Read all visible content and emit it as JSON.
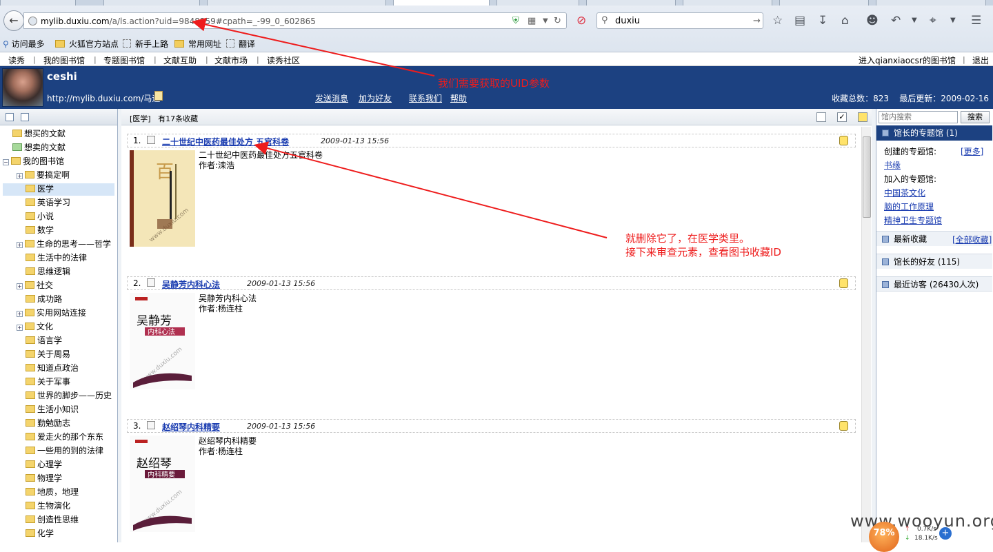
{
  "browser": {
    "url": "mylib.duxiu.com/a/ls.action?uid=9848259#cpath=_-99_0_602865",
    "url_host": "mylib.duxiu.com",
    "url_path": "/a/ls.action?uid=9848259#cpath=_-99_0_602865",
    "search_value": "duxiu",
    "bookmarks": [
      "访问最多",
      "火狐官方站点",
      "新手上路",
      "常用网址",
      "翻译"
    ]
  },
  "topnav": {
    "items": [
      "读秀",
      "我的图书馆",
      "专题图书馆",
      "文献互助",
      "文献市场",
      "读秀社区"
    ],
    "enter_text": "进入qianxiaocsr的图书馆",
    "logout": "退出"
  },
  "profile": {
    "name": "ceshi",
    "url_text": "http://mylib.duxiu.com/马迪",
    "links": [
      "发送消息",
      "加为好友",
      "联系我们",
      "帮助"
    ],
    "stats": "收藏总数：823    最后更新：2009-02-16"
  },
  "tree": {
    "items": [
      {
        "label": "想买的文献"
      },
      {
        "label": "想卖的文献"
      },
      {
        "label": "我的图书馆"
      },
      {
        "label": "要搞定啊"
      },
      {
        "label": "医学"
      },
      {
        "label": "英语学习"
      },
      {
        "label": "小说"
      },
      {
        "label": "数学"
      },
      {
        "label": "生命的思考——哲学"
      },
      {
        "label": "生活中的法律"
      },
      {
        "label": "思维逻辑"
      },
      {
        "label": "社交"
      },
      {
        "label": "成功路"
      },
      {
        "label": "实用网站连接"
      },
      {
        "label": "文化"
      },
      {
        "label": "语言学"
      },
      {
        "label": "关于周易"
      },
      {
        "label": "知道点政治"
      },
      {
        "label": "关于军事"
      },
      {
        "label": "世界的脚步——历史"
      },
      {
        "label": "生活小知识"
      },
      {
        "label": "勤勉励志"
      },
      {
        "label": "爱走火的那个东东"
      },
      {
        "label": "一些用的到的法律"
      },
      {
        "label": "心理学"
      },
      {
        "label": "物理学"
      },
      {
        "label": "地质，地理"
      },
      {
        "label": "生物演化"
      },
      {
        "label": "创造性思维"
      },
      {
        "label": "化学"
      }
    ]
  },
  "main": {
    "category": "[医学]",
    "count_text": "有17条收藏",
    "items": [
      {
        "num": "1.",
        "title": "二十世纪中医药最佳处方 五官科卷",
        "date": "2009-01-13  15:56",
        "desc_title": "二十世纪中医药最佳处方五官科卷",
        "author": "作者:滦浩"
      },
      {
        "num": "2.",
        "title": "吴静芳内科心法",
        "date": "2009-01-13  15:56",
        "desc_title": "吴静芳内科心法",
        "author": "作者:杨连柱"
      },
      {
        "num": "3.",
        "title": "赵绍琴内科精要",
        "date": "2009-01-13  15:56",
        "desc_title": "赵绍琴内科精要",
        "author": "作者:杨连柱"
      }
    ]
  },
  "right": {
    "search_placeholder": "馆内搜索",
    "search_button": "搜索",
    "topic_head": "馆长的专题馆 (1)",
    "created_label": "创建的专题馆:",
    "more": "[更多]",
    "created_link": "书缘",
    "joined_label": "加入的专题馆:",
    "joined_links": [
      "中国茶文化",
      "脑的工作原理",
      "精神卫生专题馆"
    ],
    "latest_head": "最新收藏",
    "all_fav": "[全部收藏]",
    "friends_head": "馆长的好友 (115)",
    "visitors_head": "最近访客 (26430人次)"
  },
  "annotations": {
    "uid_note": "我们需要获取的UID参数",
    "delete_note_1": "就删除它了，在医学类里。",
    "delete_note_2": "接下来审查元素，查看图书收藏ID"
  },
  "overlay": {
    "watermark": "www.wooyun.org",
    "meter": "78%",
    "up_speed": "0.7K/s",
    "down_speed": "18.1K/s"
  },
  "colors": {
    "header_bg": "#1c4181",
    "annotation": "#ee1c1c",
    "link": "#1a3cb0"
  }
}
